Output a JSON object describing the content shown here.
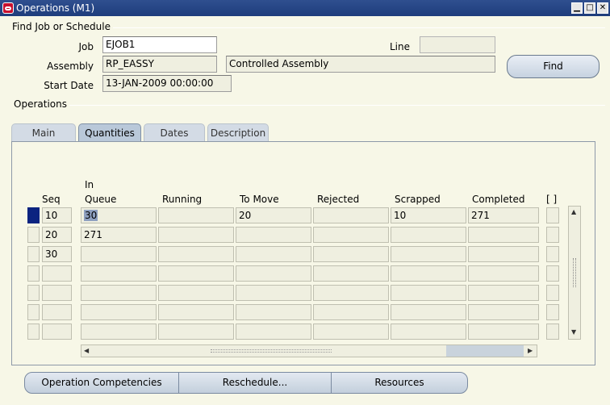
{
  "window": {
    "title": "Operations (M1)",
    "buttons": [
      "▁",
      "□",
      "✕"
    ]
  },
  "find_section": {
    "heading": "Find Job or Schedule",
    "job_label": "Job",
    "job_value": "EJOB1",
    "line_label": "Line",
    "line_value": "",
    "assembly_label": "Assembly",
    "assembly_value": "RP_EASSY",
    "assembly_desc": "Controlled Assembly",
    "start_date_label": "Start Date",
    "start_date_value": "13-JAN-2009 00:00:00",
    "find_button": "Find"
  },
  "operations_section": {
    "heading": "Operations",
    "tabs": [
      {
        "label": "Main"
      },
      {
        "label": "Quantities"
      },
      {
        "label": "Dates"
      },
      {
        "label": "Description"
      }
    ],
    "active_tab": "Quantities"
  },
  "grid": {
    "headers": {
      "seq": "Seq",
      "in_queue_line1": "In",
      "in_queue_line2": "Queue",
      "running": "Running",
      "to_move": "To Move",
      "rejected": "Rejected",
      "scrapped": "Scrapped",
      "completed": "Completed",
      "flex": "[ ]"
    },
    "rows": [
      {
        "seq": "10",
        "in_queue": "30",
        "running": "",
        "to_move": "20",
        "rejected": "",
        "scrapped": "10",
        "completed": "271"
      },
      {
        "seq": "20",
        "in_queue": "271",
        "running": "",
        "to_move": "",
        "rejected": "",
        "scrapped": "",
        "completed": ""
      },
      {
        "seq": "30",
        "in_queue": "",
        "running": "",
        "to_move": "",
        "rejected": "",
        "scrapped": "",
        "completed": ""
      },
      {
        "seq": "",
        "in_queue": "",
        "running": "",
        "to_move": "",
        "rejected": "",
        "scrapped": "",
        "completed": ""
      },
      {
        "seq": "",
        "in_queue": "",
        "running": "",
        "to_move": "",
        "rejected": "",
        "scrapped": "",
        "completed": ""
      },
      {
        "seq": "",
        "in_queue": "",
        "running": "",
        "to_move": "",
        "rejected": "",
        "scrapped": "",
        "completed": ""
      },
      {
        "seq": "",
        "in_queue": "",
        "running": "",
        "to_move": "",
        "rejected": "",
        "scrapped": "",
        "completed": ""
      }
    ]
  },
  "bottom_buttons": {
    "competencies": "Operation Competencies",
    "reschedule": "Reschedule...",
    "resources": "Resources"
  }
}
